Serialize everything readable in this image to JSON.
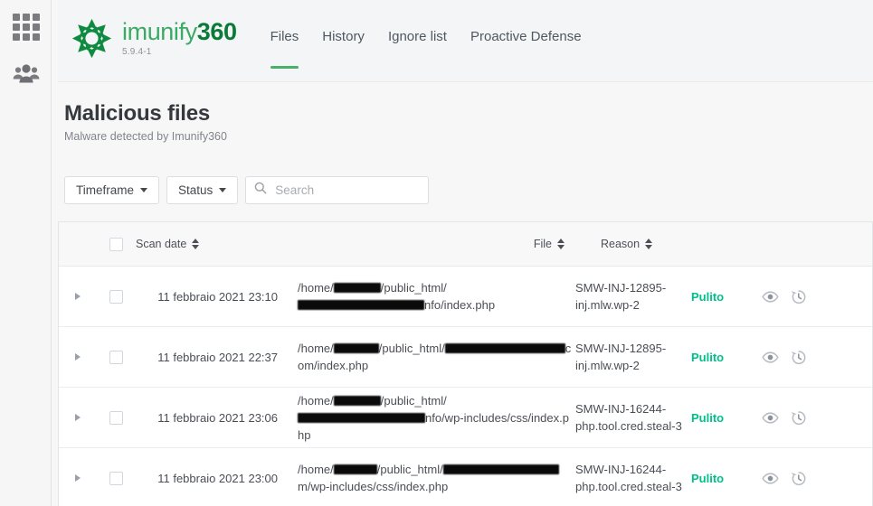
{
  "rail": {
    "items": [
      {
        "name": "apps-grid",
        "icon": "grid-icon",
        "label": "Apps"
      },
      {
        "name": "users",
        "icon": "people-icon",
        "label": "Users"
      }
    ]
  },
  "header": {
    "brand": {
      "icon": "imunify-logo-icon",
      "word_light": "imunify",
      "word_bold": "360",
      "version": "5.9.4-1"
    },
    "tabs": [
      {
        "label": "Files",
        "active": true
      },
      {
        "label": "History",
        "active": false
      },
      {
        "label": "Ignore list",
        "active": false
      },
      {
        "label": "Proactive Defense",
        "active": false
      }
    ]
  },
  "page": {
    "title": "Malicious files",
    "subtitle": "Malware detected by Imunify360"
  },
  "toolbar": {
    "timeframe_label": "Timeframe",
    "status_label": "Status",
    "search_placeholder": "Search",
    "search_value": "",
    "search_icon": "search-icon"
  },
  "table": {
    "columns": [
      {
        "key": "scan_date",
        "label": "Scan date",
        "sortable": true
      },
      {
        "key": "file",
        "label": "File",
        "sortable": true
      },
      {
        "key": "reason",
        "label": "Reason",
        "sortable": true
      }
    ],
    "select_all_checked": false,
    "rows": [
      {
        "scan_date": "11 febbraio 2021 23:10",
        "file_prefix": "/home/",
        "file_redacted_1_width": 52,
        "file_middle": "/public_html/",
        "file_redacted_2_width": 140,
        "file_suffix": "nfo/index.php",
        "reason": "SMW-INJ-12895-inj.mlw.wp-2",
        "status": "Pulito",
        "actions": [
          "eye-icon",
          "restore-icon"
        ],
        "checked": false
      },
      {
        "scan_date": "11 febbraio 2021 22:37",
        "file_prefix": "/home/",
        "file_redacted_1_width": 50,
        "file_middle": "/public_html/",
        "file_redacted_2_width": 133,
        "file_suffix": "com/index.php",
        "reason": "SMW-INJ-12895-inj.mlw.wp-2",
        "status": "Pulito",
        "actions": [
          "eye-icon",
          "restore-icon"
        ],
        "checked": false
      },
      {
        "scan_date": "11 febbraio 2021 23:06",
        "file_prefix": "/home/",
        "file_redacted_1_width": 52,
        "file_middle": "/public_html/",
        "file_redacted_2_width": 141,
        "file_suffix": "nfo/wp-includes/css/index.php",
        "reason": "SMW-INJ-16244-php.tool.cred.steal-3",
        "status": "Pulito",
        "actions": [
          "eye-icon",
          "restore-icon"
        ],
        "checked": false
      },
      {
        "scan_date": "11 febbraio 2021 23:00",
        "file_prefix": "/home/",
        "file_redacted_1_width": 48,
        "file_middle": "/public_html/",
        "file_redacted_2_width": 128,
        "file_suffix": "m/wp-includes/css/index.php",
        "reason": "SMW-INJ-16244-php.tool.cred.steal-3",
        "status": "Pulito",
        "actions": [
          "eye-icon",
          "restore-icon"
        ],
        "checked": false
      }
    ]
  },
  "colors": {
    "brand_green_light": "#3aaa64",
    "brand_green_dark": "#0b7a39",
    "tab_active_underline": "#4aaf6d",
    "status_ok": "#00c08a",
    "page_bg": "#f7f7f8",
    "card_bg": "#ffffff"
  }
}
